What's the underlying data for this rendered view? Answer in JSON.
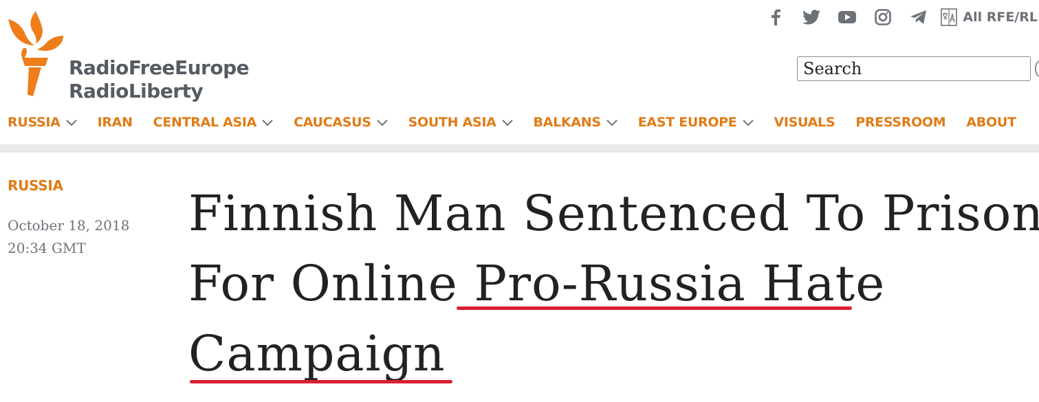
{
  "brand": {
    "line1": "RadioFreeEurope",
    "line2": "RadioLiberty",
    "accent_color": "#e07b16"
  },
  "topbar": {
    "social_icons": [
      "facebook-icon",
      "twitter-icon",
      "youtube-icon",
      "instagram-icon",
      "telegram-icon"
    ],
    "language_label": "All RFE/RL"
  },
  "search": {
    "placeholder": "Search"
  },
  "nav": {
    "items": [
      {
        "label": "RUSSIA",
        "dropdown": true
      },
      {
        "label": "IRAN",
        "dropdown": false
      },
      {
        "label": "CENTRAL ASIA",
        "dropdown": true
      },
      {
        "label": "CAUCASUS",
        "dropdown": true
      },
      {
        "label": "SOUTH ASIA",
        "dropdown": true
      },
      {
        "label": "BALKANS",
        "dropdown": true
      },
      {
        "label": "EAST EUROPE",
        "dropdown": true
      },
      {
        "label": "VISUALS",
        "dropdown": false
      },
      {
        "label": "PRESSROOM",
        "dropdown": false
      },
      {
        "label": "ABOUT",
        "dropdown": false
      }
    ]
  },
  "article": {
    "category": "RUSSIA",
    "date": "October 18, 2018",
    "time": "20:34 GMT",
    "headline_lines": [
      "Finnish Man Sentenced To Prison",
      "For Online Pro-Russia Hate",
      "Campaign"
    ],
    "underline_color": "#d9212f"
  }
}
